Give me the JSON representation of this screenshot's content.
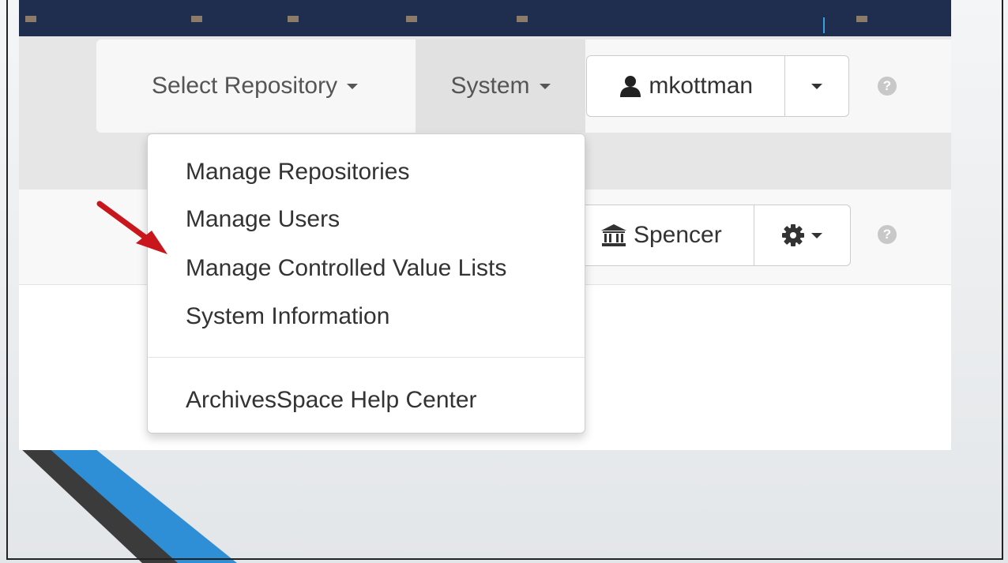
{
  "navbar": {
    "select_repository": "Select Repository",
    "system": "System",
    "user": "mkottman",
    "help": "?"
  },
  "system_menu": {
    "items": [
      "Manage Repositories",
      "Manage Users",
      "Manage Controlled Value Lists",
      "System Information"
    ],
    "help_center": "ArchivesSpace Help Center"
  },
  "repository_bar": {
    "repository": "Spencer",
    "help": "?"
  },
  "icons": {
    "user": "user-icon",
    "repository": "institution-icon",
    "settings": "gear-icon",
    "caret": "caret-down-icon",
    "help": "question-circle-icon",
    "annotation": "red-arrow-icon"
  },
  "colors": {
    "top_strip": "#1f2d4f",
    "accent_blue": "#3a9fe0",
    "arrow_red": "#c8161c"
  }
}
